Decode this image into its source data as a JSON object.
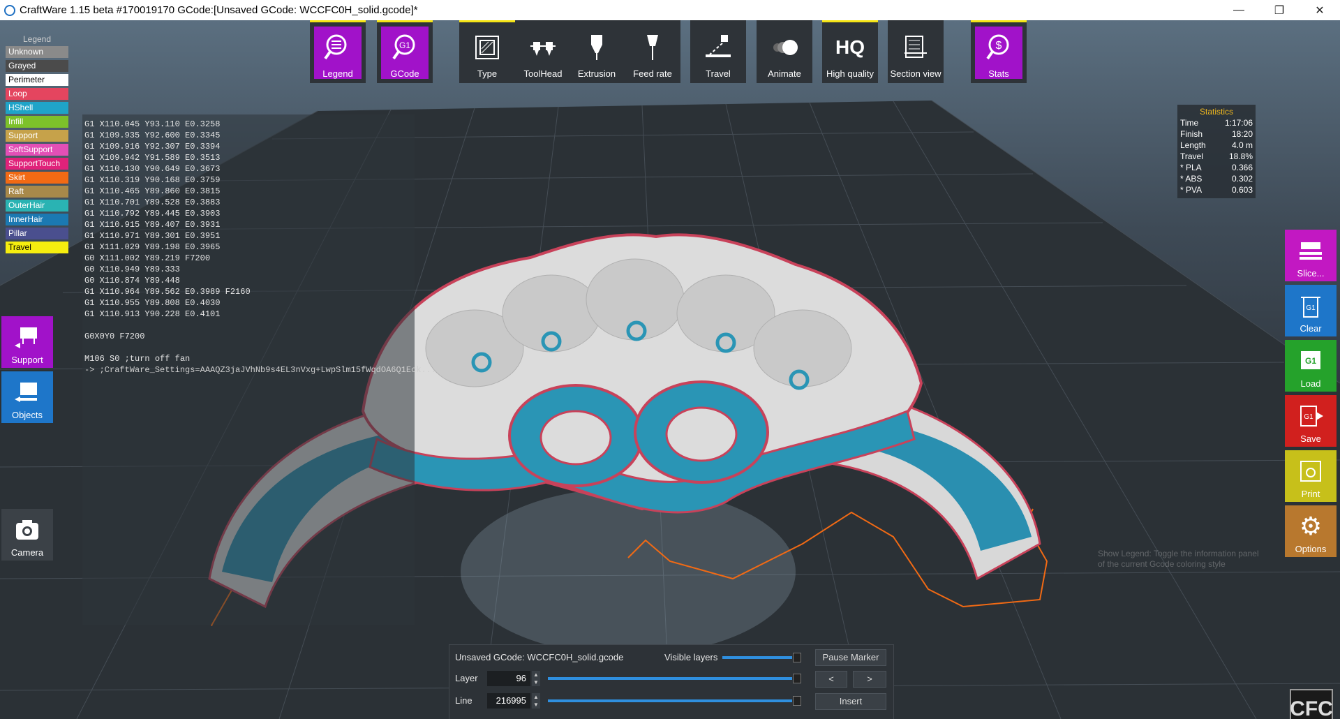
{
  "window": {
    "title": "CraftWare 1.15 beta #170019170   GCode:[Unsaved GCode: WCCFC0H_solid.gcode]*",
    "minimize": "—",
    "maximize": "❐",
    "close": "✕"
  },
  "legend": {
    "header": "Legend",
    "items": [
      {
        "label": "Unknown",
        "color": "#8a8a8a"
      },
      {
        "label": "Grayed",
        "color": "#4b4b4b"
      },
      {
        "label": "Perimeter",
        "color": "#ffffff"
      },
      {
        "label": "Loop",
        "color": "#e4455f"
      },
      {
        "label": "HShell",
        "color": "#1fa4c8"
      },
      {
        "label": "Infill",
        "color": "#7dc12a"
      },
      {
        "label": "Support",
        "color": "#c6a24a"
      },
      {
        "label": "SoftSupport",
        "color": "#e34fb6"
      },
      {
        "label": "SupportTouch",
        "color": "#e0227a"
      },
      {
        "label": "Skirt",
        "color": "#f26a14"
      },
      {
        "label": "Raft",
        "color": "#a8894a"
      },
      {
        "label": "OuterHair",
        "color": "#2ab3b3"
      },
      {
        "label": "InnerHair",
        "color": "#1b79b2"
      },
      {
        "label": "Pillar",
        "color": "#4a4f8e"
      },
      {
        "label": "Travel",
        "color": "#f6ee0f"
      }
    ]
  },
  "gcode_lines": [
    "G1 X110.045 Y93.110 E0.3258",
    "G1 X109.935 Y92.600 E0.3345",
    "G1 X109.916 Y92.307 E0.3394",
    "G1 X109.942 Y91.589 E0.3513",
    "G1 X110.130 Y90.649 E0.3673",
    "G1 X110.319 Y90.168 E0.3759",
    "G1 X110.465 Y89.860 E0.3815",
    "G1 X110.701 Y89.528 E0.3883",
    "G1 X110.792 Y89.445 E0.3903",
    "G1 X110.915 Y89.407 E0.3931",
    "G1 X110.971 Y89.301 E0.3951",
    "G1 X111.029 Y89.198 E0.3965",
    "G0 X111.002 Y89.219 F7200",
    "G0 X110.949 Y89.333",
    "G0 X110.874 Y89.448",
    "G1 X110.964 Y89.562 E0.3989 F2160",
    "G1 X110.955 Y89.808 E0.4030",
    "G1 X110.913 Y90.228 E0.4101",
    "",
    "G0X0Y0 F7200",
    "",
    "M106 S0 ;turn off fan",
    "-> ;CraftWare_Settings=AAAQZ3jaJVhNb9s4EL3nVxg+LwpSlm15fWqdOA6Q1Eck..."
  ],
  "toolbar": {
    "legend": "Legend",
    "gcode": "GCode",
    "type": "Type",
    "toolhead": "ToolHead",
    "extrusion": "Extrusion",
    "feedrate": "Feed rate",
    "travel": "Travel",
    "animate": "Animate",
    "hq_icon": "HQ",
    "highquality": "High quality",
    "sectionview": "Section view",
    "stats": "Stats",
    "g1_icon": "G1"
  },
  "left_buttons": {
    "support": "Support",
    "objects": "Objects",
    "camera": "Camera"
  },
  "right_buttons": {
    "slice": "Slice...",
    "clear": "Clear",
    "load": "Load",
    "save": "Save",
    "print": "Print",
    "options": "Options"
  },
  "statistics": {
    "header": "Statistics",
    "rows": [
      {
        "k": "Time",
        "v": "1:17:06"
      },
      {
        "k": "Finish",
        "v": "18:20"
      },
      {
        "k": "Length",
        "v": "4.0 m"
      },
      {
        "k": "Travel",
        "v": "18.8%"
      },
      {
        "k": "* PLA",
        "v": "0.366"
      },
      {
        "k": "* ABS",
        "v": "0.302"
      },
      {
        "k": "* PVA",
        "v": "0.603"
      }
    ]
  },
  "bottom": {
    "filename": "Unsaved GCode: WCCFC0H_solid.gcode",
    "visible_layers_label": "Visible layers",
    "layer_label": "Layer",
    "layer_value": "96",
    "line_label": "Line",
    "line_value": "216995",
    "pause_marker": "Pause Marker",
    "prev": "<",
    "next": ">",
    "insert": "Insert"
  },
  "hint": "Show Legend: Toggle the information panel of the current Gcode coloring style",
  "logo": "CFC"
}
